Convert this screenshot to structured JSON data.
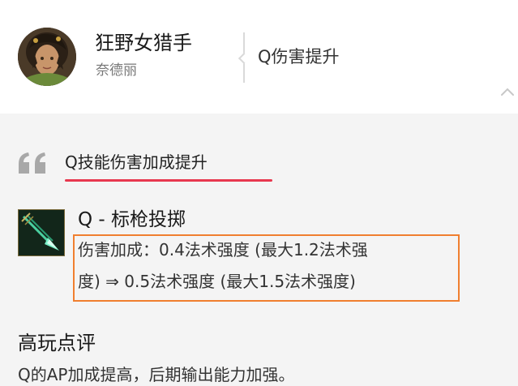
{
  "champion": {
    "name": "狂野女猎手",
    "title": "奈德丽",
    "avatar_icon": "champion-portrait-icon"
  },
  "change_summary": "Q伤害提升",
  "headline": "Q技能伤害加成提升",
  "ability": {
    "name": "Q - 标枪投掷",
    "icon": "javelin-toss-icon",
    "detail_line_1": "伤害加成：0.4法术强度 (最大1.2法术强",
    "detail_line_2": "度) ⇒ 0.5法术强度 (最大1.5法术强度)"
  },
  "review": {
    "heading": "高玩点评",
    "text": "Q的AP加成提高，后期输出能力加强。"
  },
  "colors": {
    "accent_underline": "#e8384f",
    "highlight_box": "#f07f2f",
    "background": "#f4f4f4",
    "header_bg": "#ffffff"
  }
}
